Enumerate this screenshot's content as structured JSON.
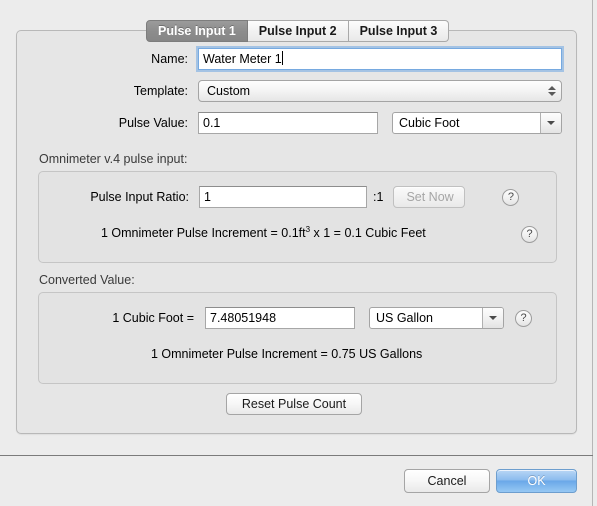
{
  "tabs": [
    {
      "label": "Pulse Input 1",
      "active": true
    },
    {
      "label": "Pulse Input 2",
      "active": false
    },
    {
      "label": "Pulse Input 3",
      "active": false
    }
  ],
  "form": {
    "name_label": "Name:",
    "name_value": "Water Meter 1",
    "template_label": "Template:",
    "template_value": "Custom",
    "pulse_value_label": "Pulse Value:",
    "pulse_value": "0.1",
    "pulse_unit": "Cubic Foot"
  },
  "omnimeter_group": {
    "title": "Omnimeter v.4 pulse input:",
    "ratio_label": "Pulse Input Ratio:",
    "ratio_value": "1",
    "ratio_suffix": ":1",
    "set_now_label": "Set Now",
    "increment_prefix": "1 Omnimeter Pulse Increment = 0.1ft",
    "increment_superscript": "3",
    "increment_suffix": " x 1 = 0.1 Cubic Feet",
    "help_icon": "?"
  },
  "converted_group": {
    "title": "Converted Value:",
    "from_label": "1 Cubic Foot =",
    "conversion_value": "7.48051948",
    "conversion_unit": "US Gallon",
    "increment_text": "1 Omnimeter Pulse Increment = 0.75 US Gallons",
    "help_icon": "?"
  },
  "actions": {
    "reset_label": "Reset Pulse Count",
    "cancel_label": "Cancel",
    "ok_label": "OK"
  },
  "colors": {
    "window_bg": "#ececec",
    "panel_bg": "#e6e6e6",
    "group_bg": "#e3e3e3",
    "active_tab_bg": "#8d8d8d",
    "focus_ring": "#6ea5e1",
    "default_button": "#6aa8e8"
  }
}
